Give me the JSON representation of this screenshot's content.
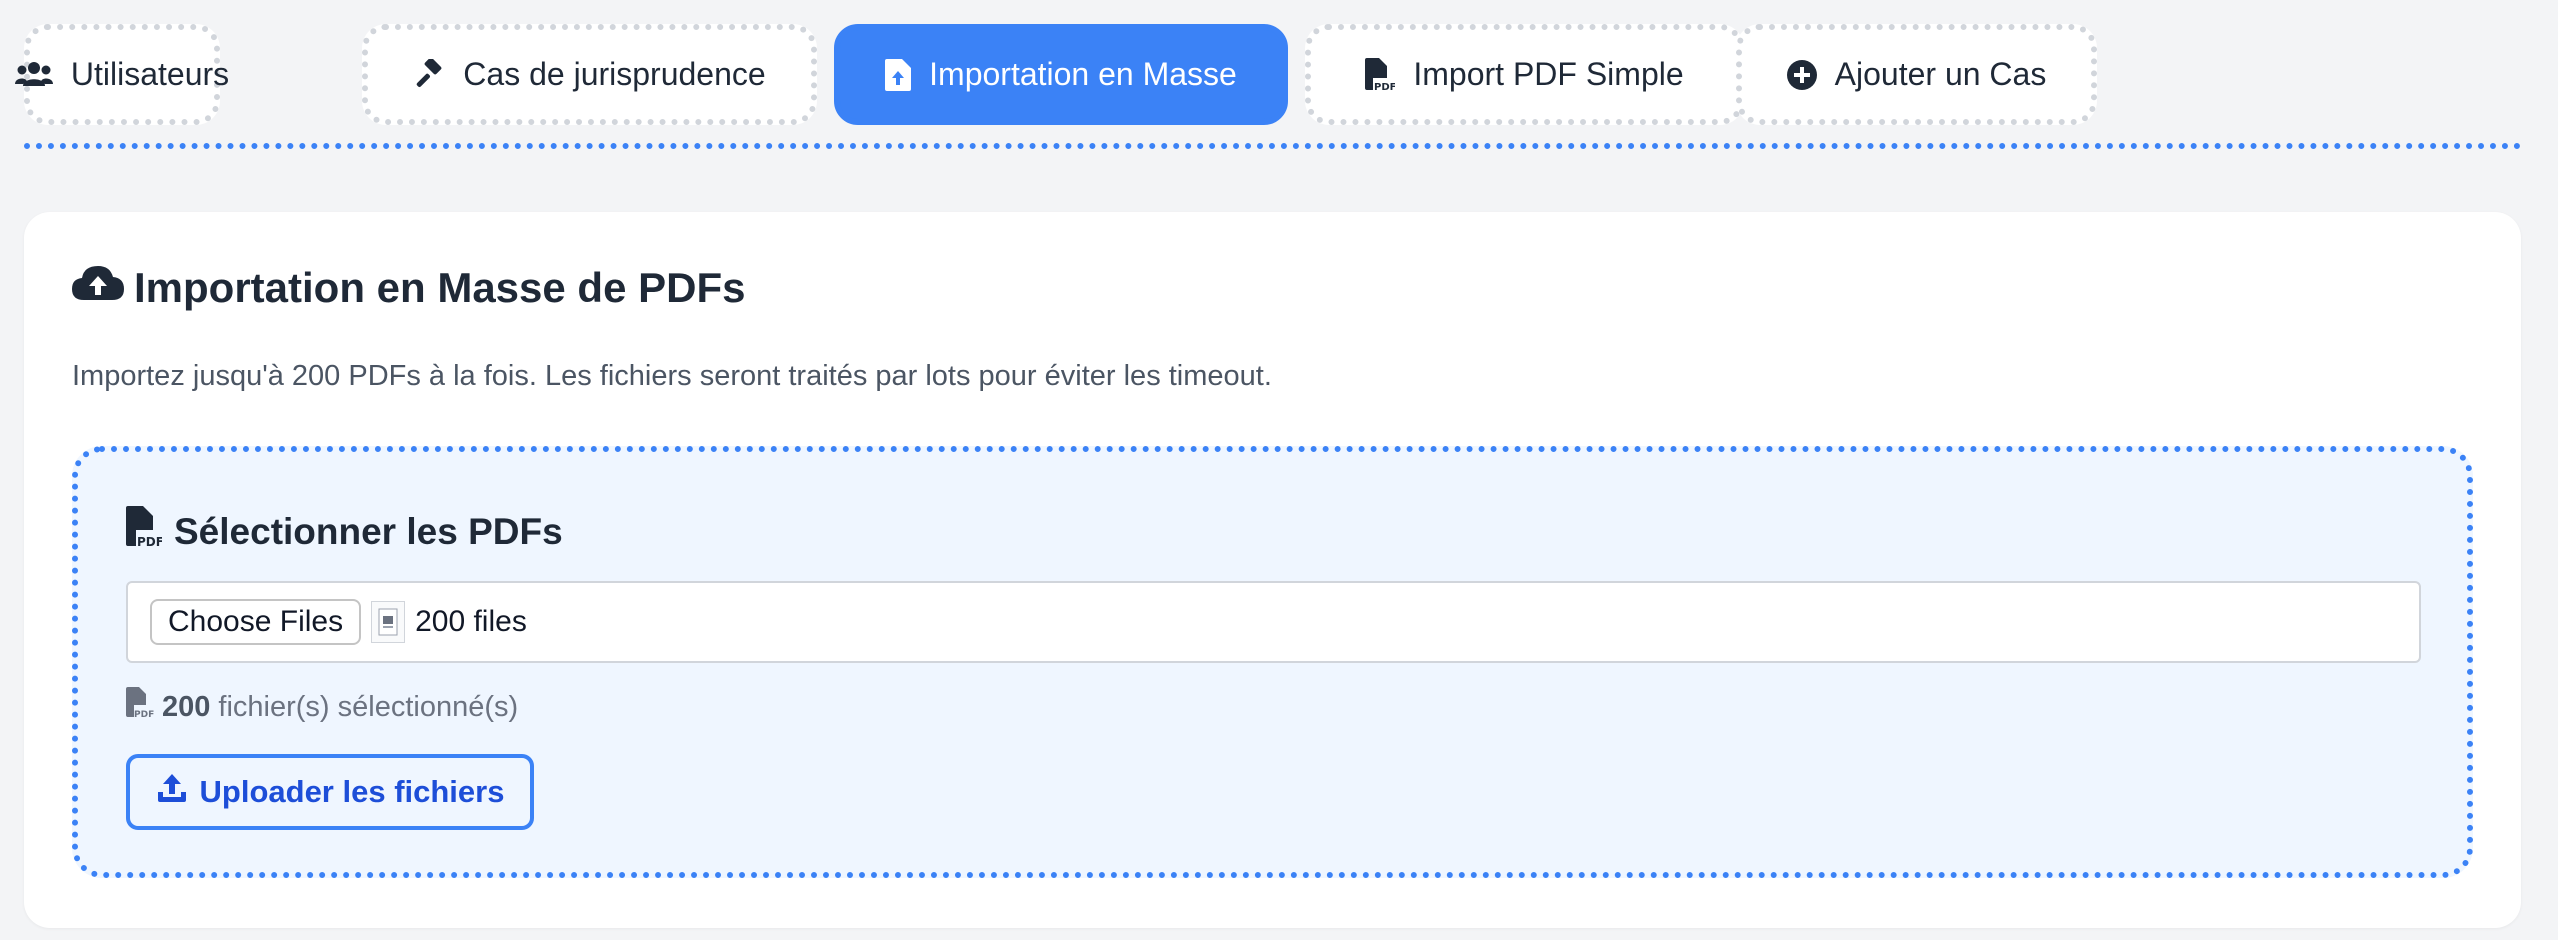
{
  "tabs": [
    {
      "label": "Utilisateurs",
      "icon": "users-icon",
      "active": false
    },
    {
      "label": "Cas de jurisprudence",
      "icon": "gavel-icon",
      "active": false
    },
    {
      "label": "Importation en Masse",
      "icon": "file-upload-icon",
      "active": true
    },
    {
      "label": "Import PDF Simple",
      "icon": "file-pdf-icon",
      "active": false
    },
    {
      "label": "Ajouter un Cas",
      "icon": "plus-circle-icon",
      "active": false
    }
  ],
  "card": {
    "title": "Importation en Masse de PDFs",
    "title_icon": "cloud-upload-icon",
    "description": "Importez jusqu'à 200 PDFs à la fois. Les fichiers seront traités par lots pour éviter les timeout."
  },
  "dropzone": {
    "title": "Sélectionner les PDFs",
    "title_icon": "file-pdf-icon",
    "file_input": {
      "button_label": "Choose Files",
      "value": "200 files"
    },
    "selected": {
      "count": "200",
      "suffix": "fichier(s) sélectionné(s)"
    },
    "upload_button": "Uploader les fichiers",
    "upload_icon": "upload-icon"
  },
  "colors": {
    "accent": "#3b82f6",
    "accent_dark": "#1d4ed8",
    "dropzone_bg": "#eff6ff",
    "page_bg": "#f3f4f6"
  }
}
